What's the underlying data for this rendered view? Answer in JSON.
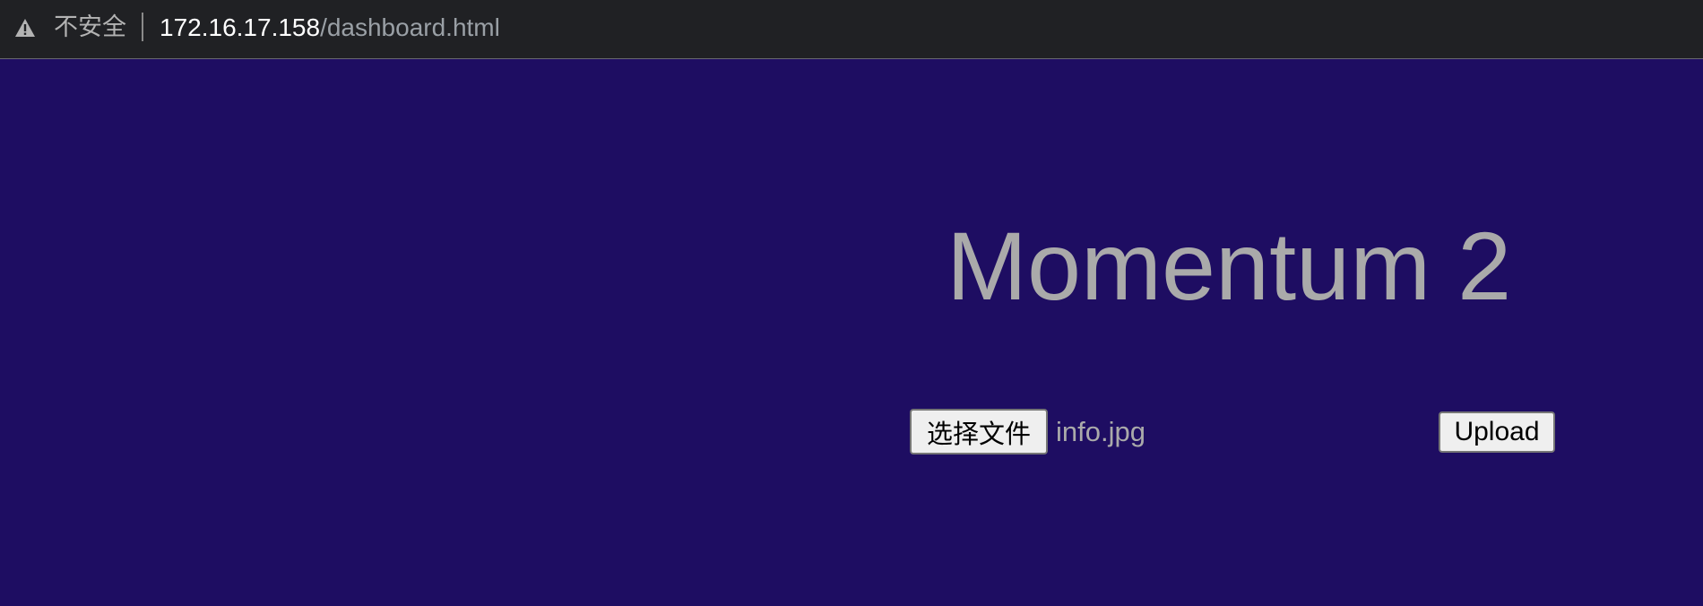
{
  "browser": {
    "security_label": "不安全",
    "url_host": "172.16.17.158",
    "url_path": "/dashboard.html",
    "icons": {
      "security": "warning-triangle-icon"
    }
  },
  "page": {
    "title": "Momentum 2",
    "file_input": {
      "button_label": "选择文件",
      "selected_file": "info.jpg"
    },
    "upload_button_label": "Upload"
  },
  "colors": {
    "page_background": "#1e0d62",
    "title_text": "#aaaaaa",
    "toolbar_background": "#202124",
    "button_background": "#efefef"
  }
}
